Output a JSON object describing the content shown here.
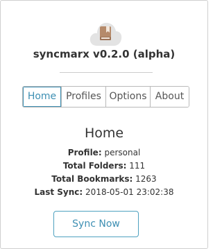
{
  "app": {
    "title": "syncmarx v0.2.0 (alpha)",
    "logo_icon": "cloud-bookmark-icon"
  },
  "tabs": [
    {
      "label": "Home",
      "active": true
    },
    {
      "label": "Profiles",
      "active": false
    },
    {
      "label": "Options",
      "active": false
    },
    {
      "label": "About",
      "active": false
    }
  ],
  "home": {
    "title": "Home",
    "profile_label": "Profile:",
    "profile_value": "personal",
    "folders_label": "Total Folders:",
    "folders_value": "111",
    "bookmarks_label": "Total Bookmarks:",
    "bookmarks_value": "1263",
    "last_sync_label": "Last Sync:",
    "last_sync_value": "2018-05-01 23:02:38",
    "sync_button_label": "Sync Now"
  },
  "colors": {
    "accent": "#3d8fb3",
    "logo_cloud": "#e3e3e3",
    "logo_book": "#b58a6a"
  }
}
